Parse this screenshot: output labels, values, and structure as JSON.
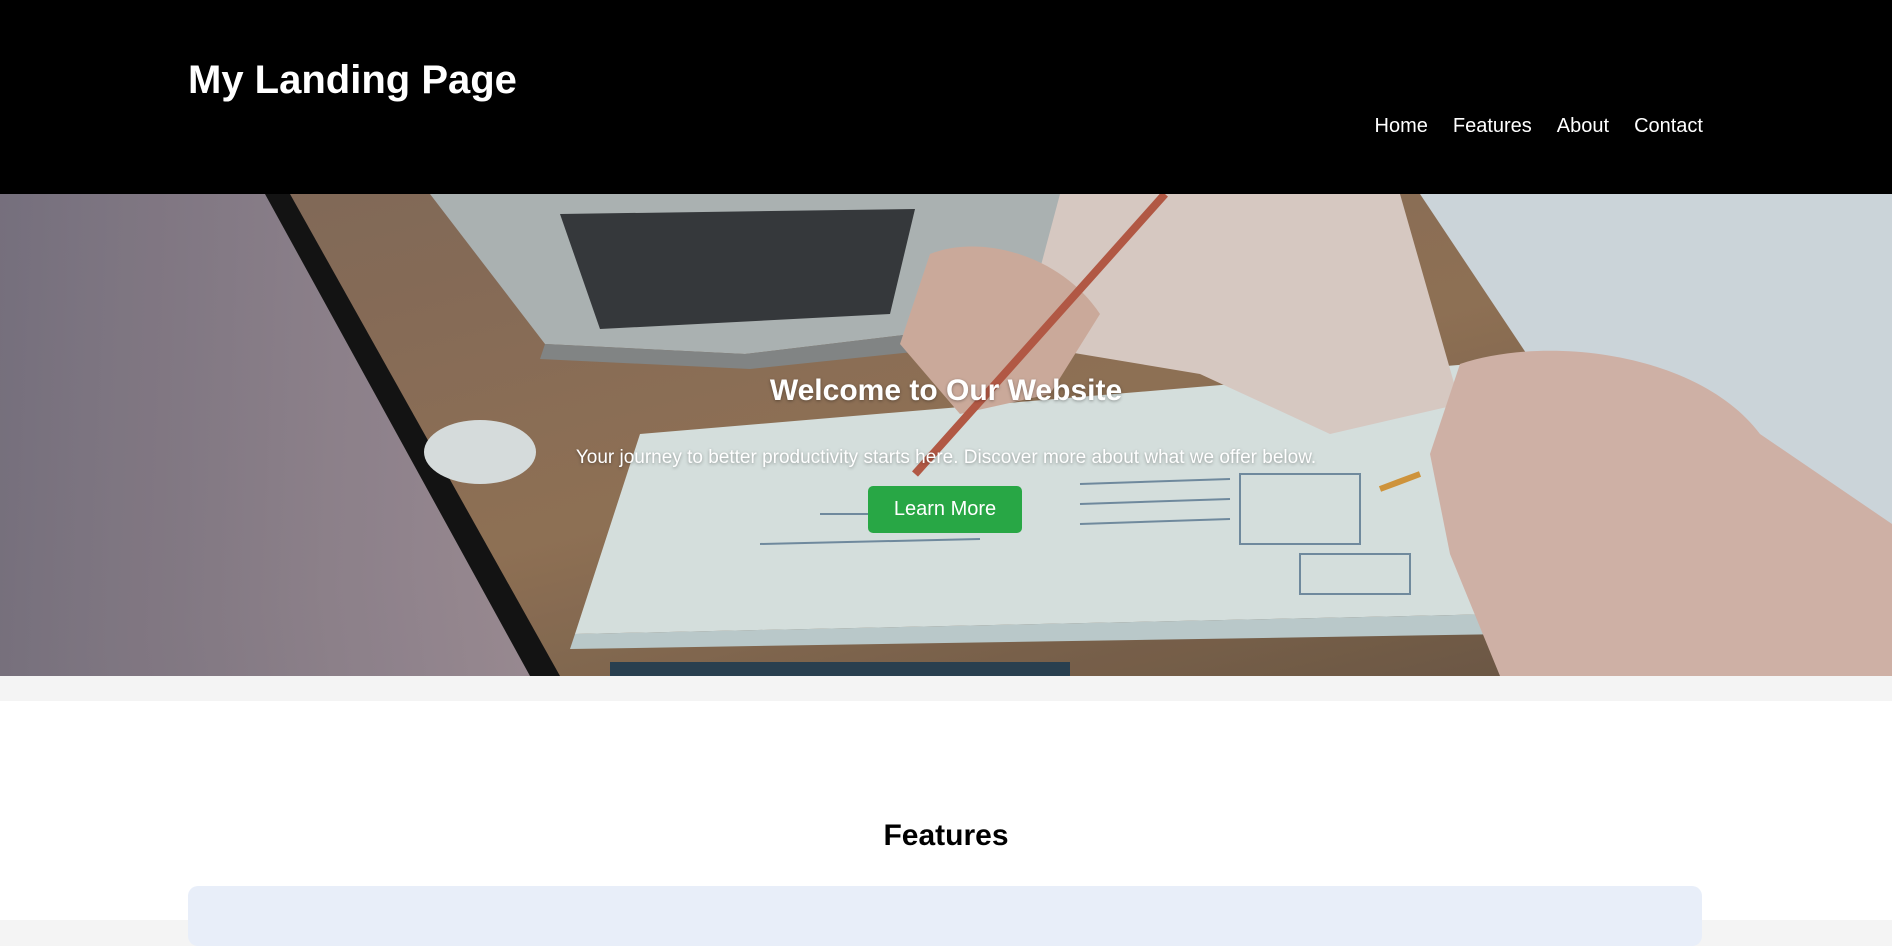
{
  "header": {
    "title": "My Landing Page",
    "nav": [
      {
        "label": "Home"
      },
      {
        "label": "Features"
      },
      {
        "label": "About"
      },
      {
        "label": "Contact"
      }
    ]
  },
  "hero": {
    "heading": "Welcome to Our Website",
    "subtext": "Your journey to better productivity starts here. Discover more about what we offer below.",
    "button_label": "Learn More",
    "background_image": "office-desk-laptop-papers-image"
  },
  "features": {
    "heading": "Features"
  },
  "colors": {
    "header_bg": "#000000",
    "button_bg": "#28a745",
    "card_bg": "#e8eef9",
    "page_bg": "#f4f4f4"
  }
}
